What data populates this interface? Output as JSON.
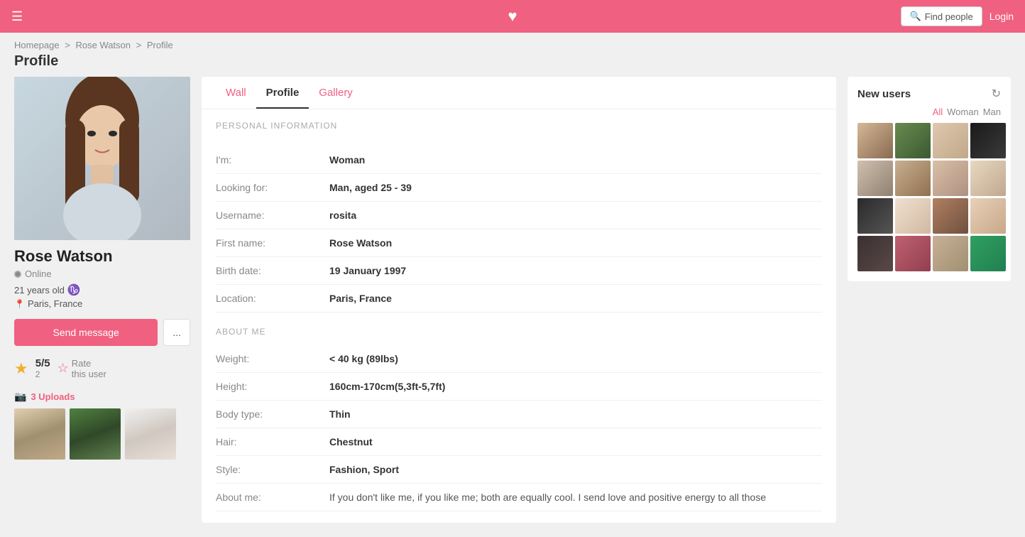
{
  "header": {
    "heart": "♥",
    "find_people": "Find people",
    "login": "Login"
  },
  "breadcrumb": {
    "homepage": "Homepage",
    "sep1": ">",
    "user": "Rose Watson",
    "sep2": ">",
    "current": "Profile"
  },
  "page_title": "Profile",
  "left": {
    "user_name": "Rose Watson",
    "online_label": "Online",
    "age": "21 years old",
    "zodiac": "♑",
    "location": "Paris, France",
    "send_message": "Send message",
    "more_dots": "...",
    "rating_score": "5/5",
    "rating_count": "2",
    "rate_label": "Rate",
    "rate_sublabel": "this user",
    "uploads_label": "3 Uploads"
  },
  "tabs": [
    {
      "id": "wall",
      "label": "Wall"
    },
    {
      "id": "profile",
      "label": "Profile",
      "active": true
    },
    {
      "id": "gallery",
      "label": "Gallery"
    }
  ],
  "profile": {
    "personal_info_header": "PERSONAL INFORMATION",
    "fields": [
      {
        "label": "I'm:",
        "value": "Woman"
      },
      {
        "label": "Looking for:",
        "value": "Man, aged 25 - 39"
      },
      {
        "label": "Username:",
        "value": "rosita"
      },
      {
        "label": "First name:",
        "value": "Rose Watson"
      },
      {
        "label": "Birth date:",
        "value": "19 January 1997"
      },
      {
        "label": "Location:",
        "value": "Paris, France"
      }
    ],
    "about_me_header": "ABOUT ME",
    "about_fields": [
      {
        "label": "Weight:",
        "value": "< 40 kg (89lbs)"
      },
      {
        "label": "Height:",
        "value": "160cm-170cm(5,3ft-5,7ft)"
      },
      {
        "label": "Body type:",
        "value": "Thin"
      },
      {
        "label": "Hair:",
        "value": "Chestnut"
      },
      {
        "label": "Style:",
        "value": "Fashion, Sport"
      },
      {
        "label": "About me:",
        "value": "If you don't like me, if you like me; both are equally cool. I send love and positive energy to all those"
      }
    ]
  },
  "new_users": {
    "title": "New users",
    "filter_all": "All",
    "filter_woman": "Woman",
    "filter_man": "Man",
    "thumbnails": [
      "ut1",
      "ut2",
      "ut3",
      "ut4",
      "ut5",
      "ut6",
      "ut7",
      "ut8",
      "ut9",
      "ut10",
      "ut11",
      "ut12",
      "ut13",
      "ut14",
      "ut15",
      "ut16"
    ]
  }
}
